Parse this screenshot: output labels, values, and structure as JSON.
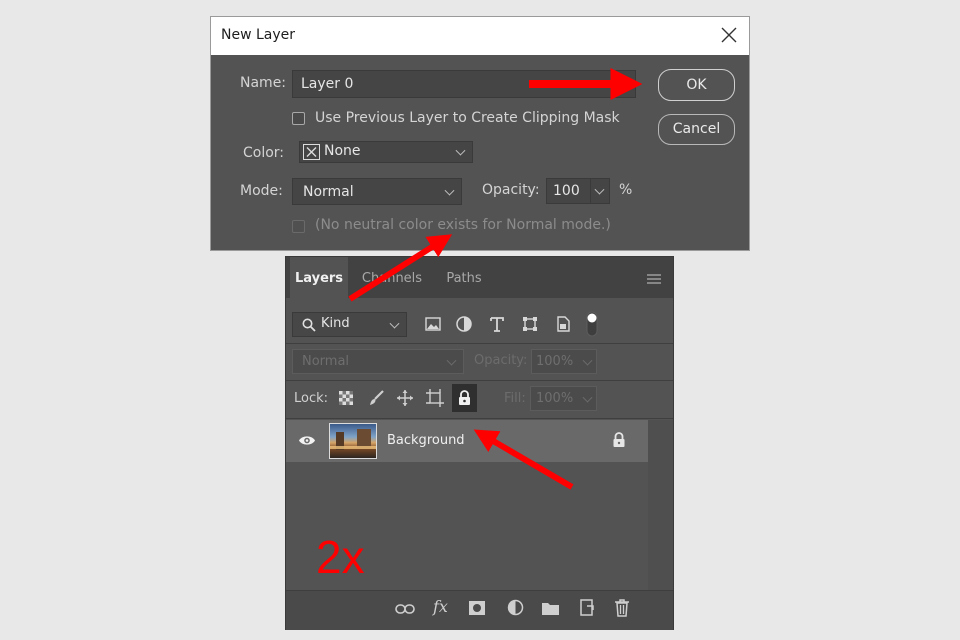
{
  "dialog": {
    "title": "New Layer",
    "name_label": "Name:",
    "name_value": "Layer 0",
    "clipping_label": "Use Previous Layer to Create Clipping Mask",
    "color_label": "Color:",
    "color_value": "None",
    "mode_label": "Mode:",
    "mode_value": "Normal",
    "opacity_label": "Opacity:",
    "opacity_value": "100",
    "opacity_unit": "%",
    "neutral_label": "(No neutral color exists for Normal mode.)",
    "ok_label": "OK",
    "cancel_label": "Cancel"
  },
  "panel": {
    "tabs": [
      "Layers",
      "Channels",
      "Paths"
    ],
    "filter_label": "Kind",
    "blend_mode": "Normal",
    "opacity_label": "Opacity:",
    "opacity_value": "100%",
    "lock_label": "Lock:",
    "fill_label": "Fill:",
    "fill_value": "100%",
    "layer_name": "Background"
  },
  "annotation": {
    "text": "2x",
    "color": "#ff0000"
  }
}
